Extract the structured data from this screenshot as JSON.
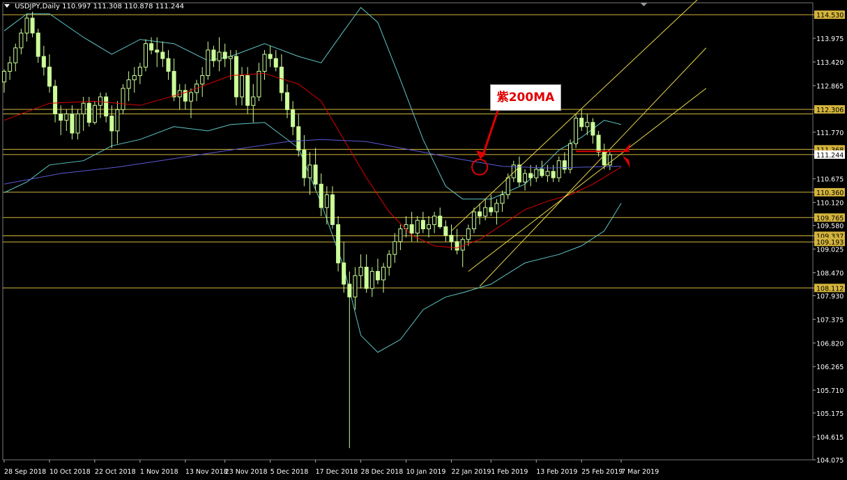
{
  "header": {
    "symbol": "USDJPY,Daily",
    "ohlc": "110.997 111.308 110.878 111.244"
  },
  "annotation": {
    "text": "紫200MA"
  },
  "colors": {
    "background": "#000000",
    "candle": "#ccff99",
    "bollinger": "#5fc7c7",
    "ma_red": "#e00000",
    "ma_purple": "#5a5ad6",
    "hline": "#d4b43c",
    "channel": "#e8d84a",
    "marker": "#e00000",
    "grid_text": "#ffffff"
  },
  "chart_data": {
    "type": "candlestick",
    "symbol": "USDJPY",
    "timeframe": "Daily",
    "ylim": [
      104.075,
      114.81
    ],
    "y_ticks": [
      114.53,
      113.975,
      113.42,
      112.865,
      112.306,
      111.77,
      111.368,
      111.244,
      110.675,
      110.36,
      110.12,
      109.765,
      109.58,
      109.337,
      109.193,
      109.025,
      108.47,
      108.112,
      107.93,
      107.375,
      106.82,
      106.265,
      105.71,
      105.175,
      104.615,
      104.075
    ],
    "highlighted_levels": [
      114.53,
      112.306,
      111.368,
      111.244,
      110.36,
      109.765,
      109.337,
      109.193,
      108.112
    ],
    "horizontal_lines": [
      114.53,
      112.306,
      112.2,
      111.368,
      111.244,
      110.36,
      109.765,
      109.337,
      109.193,
      108.112
    ],
    "x_tick_labels": [
      "28 Sep 2018",
      "10 Oct 2018",
      "22 Oct 2018",
      "1 Nov 2018",
      "13 Nov 2018",
      "23 Nov 2018",
      "5 Dec 2018",
      "17 Dec 2018",
      "28 Dec 2018",
      "10 Jan 2019",
      "22 Jan 2019",
      "1 Feb 2019",
      "13 Feb 2019",
      "25 Feb 2019",
      "7 Mar 2019"
    ],
    "x_tick_index": [
      0,
      8,
      16,
      24,
      32,
      39,
      47,
      55,
      63,
      71,
      79,
      86,
      94,
      102,
      109
    ],
    "candles": [
      [
        112.95,
        113.25,
        112.7,
        113.2
      ],
      [
        113.2,
        113.55,
        113.0,
        113.4
      ],
      [
        113.4,
        113.85,
        113.2,
        113.75
      ],
      [
        113.75,
        114.2,
        113.6,
        114.1
      ],
      [
        114.1,
        114.55,
        113.9,
        114.45
      ],
      [
        114.45,
        114.6,
        114.0,
        114.1
      ],
      [
        114.1,
        114.2,
        113.4,
        113.55
      ],
      [
        113.55,
        113.8,
        113.1,
        113.3
      ],
      [
        113.3,
        113.6,
        112.7,
        112.85
      ],
      [
        112.85,
        113.0,
        112.0,
        112.2
      ],
      [
        112.2,
        112.4,
        111.7,
        112.05
      ],
      [
        112.05,
        112.3,
        111.8,
        112.2
      ],
      [
        112.2,
        112.4,
        111.6,
        111.75
      ],
      [
        111.75,
        112.3,
        111.6,
        112.2
      ],
      [
        112.2,
        112.6,
        111.8,
        112.45
      ],
      [
        112.45,
        112.6,
        111.9,
        112.0
      ],
      [
        112.0,
        112.5,
        111.95,
        112.4
      ],
      [
        112.4,
        112.7,
        112.1,
        112.6
      ],
      [
        112.6,
        112.7,
        112.0,
        112.15
      ],
      [
        112.15,
        112.4,
        111.4,
        111.8
      ],
      [
        111.8,
        112.5,
        111.5,
        112.3
      ],
      [
        112.3,
        112.9,
        112.2,
        112.8
      ],
      [
        112.8,
        113.2,
        112.5,
        113.0
      ],
      [
        113.0,
        113.3,
        112.7,
        113.1
      ],
      [
        113.1,
        113.4,
        112.9,
        113.3
      ],
      [
        113.3,
        113.95,
        113.2,
        113.85
      ],
      [
        113.85,
        114.0,
        113.6,
        113.7
      ],
      [
        113.7,
        114.0,
        113.3,
        113.65
      ],
      [
        113.65,
        113.9,
        113.3,
        113.5
      ],
      [
        113.5,
        113.7,
        113.0,
        113.2
      ],
      [
        113.2,
        113.5,
        112.5,
        112.6
      ],
      [
        112.6,
        112.9,
        112.3,
        112.75
      ],
      [
        112.75,
        112.9,
        112.3,
        112.5
      ],
      [
        112.5,
        112.8,
        112.1,
        112.7
      ],
      [
        112.7,
        113.0,
        112.5,
        112.9
      ],
      [
        112.9,
        113.3,
        112.6,
        113.1
      ],
      [
        113.1,
        113.9,
        113.0,
        113.7
      ],
      [
        113.7,
        113.8,
        113.3,
        113.45
      ],
      [
        113.45,
        114.0,
        113.2,
        113.65
      ],
      [
        113.65,
        113.85,
        113.3,
        113.5
      ],
      [
        113.5,
        113.7,
        113.0,
        113.55
      ],
      [
        113.55,
        113.7,
        112.4,
        112.6
      ],
      [
        112.6,
        113.3,
        112.4,
        113.1
      ],
      [
        113.1,
        113.3,
        112.2,
        112.4
      ],
      [
        112.4,
        112.9,
        112.0,
        112.6
      ],
      [
        112.6,
        113.4,
        112.5,
        113.2
      ],
      [
        113.2,
        113.7,
        113.0,
        113.6
      ],
      [
        113.6,
        113.8,
        113.3,
        113.5
      ],
      [
        113.5,
        113.7,
        113.2,
        113.3
      ],
      [
        113.3,
        113.6,
        112.5,
        112.7
      ],
      [
        112.7,
        112.9,
        112.1,
        112.3
      ],
      [
        112.3,
        112.5,
        111.7,
        111.9
      ],
      [
        111.9,
        112.2,
        111.2,
        111.35
      ],
      [
        111.35,
        111.7,
        110.5,
        110.7
      ],
      [
        110.7,
        111.3,
        110.3,
        111.0
      ],
      [
        111.0,
        111.4,
        110.4,
        110.55
      ],
      [
        110.55,
        110.8,
        109.8,
        110.0
      ],
      [
        110.0,
        110.5,
        109.6,
        110.3
      ],
      [
        110.3,
        110.5,
        109.5,
        109.6
      ],
      [
        109.6,
        109.8,
        108.5,
        108.7
      ],
      [
        108.7,
        109.2,
        108.0,
        108.2
      ],
      [
        108.2,
        108.5,
        104.35,
        107.9
      ],
      [
        107.9,
        108.6,
        107.6,
        108.4
      ],
      [
        108.4,
        108.9,
        108.1,
        108.6
      ],
      [
        108.6,
        108.9,
        108.0,
        108.1
      ],
      [
        108.1,
        108.6,
        107.9,
        108.5
      ],
      [
        108.5,
        108.8,
        108.2,
        108.3
      ],
      [
        108.3,
        108.7,
        108.0,
        108.6
      ],
      [
        108.6,
        109.0,
        108.4,
        108.9
      ],
      [
        108.9,
        109.4,
        108.7,
        109.2
      ],
      [
        109.2,
        109.6,
        109.0,
        109.5
      ],
      [
        109.5,
        109.8,
        109.3,
        109.6
      ],
      [
        109.6,
        109.9,
        109.2,
        109.4
      ],
      [
        109.4,
        109.8,
        109.2,
        109.7
      ],
      [
        109.7,
        109.9,
        109.4,
        109.5
      ],
      [
        109.5,
        109.8,
        109.3,
        109.6
      ],
      [
        109.6,
        109.9,
        109.4,
        109.8
      ],
      [
        109.8,
        110.0,
        109.5,
        109.55
      ],
      [
        109.55,
        109.7,
        109.2,
        109.35
      ],
      [
        109.35,
        109.6,
        109.0,
        109.2
      ],
      [
        109.2,
        109.5,
        108.9,
        109.0
      ],
      [
        109.0,
        109.3,
        108.6,
        109.25
      ],
      [
        109.25,
        109.6,
        109.1,
        109.5
      ],
      [
        109.5,
        110.0,
        109.4,
        109.9
      ],
      [
        109.9,
        110.1,
        109.6,
        109.8
      ],
      [
        109.8,
        110.2,
        109.7,
        110.0
      ],
      [
        110.0,
        110.3,
        109.8,
        109.9
      ],
      [
        109.9,
        110.2,
        109.6,
        110.1
      ],
      [
        110.1,
        110.4,
        109.9,
        110.3
      ],
      [
        110.3,
        110.8,
        110.2,
        110.7
      ],
      [
        110.7,
        111.1,
        110.6,
        111.0
      ],
      [
        111.0,
        111.2,
        110.5,
        110.6
      ],
      [
        110.6,
        110.9,
        110.4,
        110.8
      ],
      [
        110.8,
        111.0,
        110.5,
        110.7
      ],
      [
        110.7,
        111.0,
        110.6,
        110.9
      ],
      [
        110.9,
        111.1,
        110.7,
        110.75
      ],
      [
        110.75,
        111.0,
        110.6,
        110.85
      ],
      [
        110.85,
        111.0,
        110.6,
        110.7
      ],
      [
        110.7,
        111.2,
        110.6,
        111.1
      ],
      [
        111.1,
        111.3,
        110.8,
        110.9
      ],
      [
        110.9,
        111.6,
        110.8,
        111.5
      ],
      [
        111.5,
        112.2,
        111.4,
        112.1
      ],
      [
        112.1,
        112.3,
        111.8,
        111.9
      ],
      [
        111.9,
        112.2,
        111.7,
        112.0
      ],
      [
        112.0,
        112.1,
        111.5,
        111.7
      ],
      [
        111.7,
        111.8,
        111.2,
        111.3
      ],
      [
        111.3,
        111.5,
        110.9,
        111.0
      ],
      [
        111.0,
        111.31,
        110.88,
        111.24
      ]
    ],
    "ma_red": [
      [
        0,
        112.05
      ],
      [
        8,
        112.45
      ],
      [
        16,
        112.5
      ],
      [
        24,
        112.4
      ],
      [
        32,
        112.7
      ],
      [
        40,
        113.1
      ],
      [
        46,
        113.15
      ],
      [
        52,
        112.9
      ],
      [
        56,
        112.5
      ],
      [
        60,
        111.6
      ],
      [
        64,
        110.7
      ],
      [
        68,
        109.9
      ],
      [
        72,
        109.35
      ],
      [
        76,
        109.1
      ],
      [
        80,
        109.05
      ],
      [
        84,
        109.25
      ],
      [
        88,
        109.6
      ],
      [
        92,
        109.95
      ],
      [
        96,
        110.15
      ],
      [
        100,
        110.3
      ],
      [
        104,
        110.55
      ],
      [
        109,
        110.95
      ]
    ],
    "ma_purple": [
      [
        0,
        110.55
      ],
      [
        10,
        110.8
      ],
      [
        20,
        110.95
      ],
      [
        30,
        111.15
      ],
      [
        40,
        111.35
      ],
      [
        50,
        111.55
      ],
      [
        56,
        111.6
      ],
      [
        64,
        111.55
      ],
      [
        72,
        111.35
      ],
      [
        80,
        111.15
      ],
      [
        88,
        110.97
      ],
      [
        96,
        110.93
      ],
      [
        109,
        110.97
      ]
    ],
    "bb_upper": [
      [
        0,
        114.15
      ],
      [
        4,
        114.55
      ],
      [
        8,
        114.55
      ],
      [
        14,
        114.0
      ],
      [
        19,
        113.6
      ],
      [
        24,
        113.95
      ],
      [
        30,
        113.85
      ],
      [
        36,
        113.45
      ],
      [
        40,
        113.55
      ],
      [
        46,
        113.85
      ],
      [
        52,
        113.55
      ],
      [
        56,
        113.4
      ],
      [
        60,
        114.15
      ],
      [
        63,
        114.7
      ],
      [
        66,
        114.35
      ],
      [
        70,
        113.0
      ],
      [
        74,
        111.6
      ],
      [
        78,
        110.5
      ],
      [
        81,
        110.2
      ],
      [
        86,
        110.2
      ],
      [
        92,
        110.55
      ],
      [
        98,
        111.35
      ],
      [
        102,
        111.65
      ],
      [
        106,
        112.05
      ],
      [
        109,
        111.95
      ]
    ],
    "bb_lower": [
      [
        0,
        110.35
      ],
      [
        4,
        110.6
      ],
      [
        8,
        111.0
      ],
      [
        14,
        111.1
      ],
      [
        19,
        111.45
      ],
      [
        24,
        111.6
      ],
      [
        30,
        111.9
      ],
      [
        36,
        111.8
      ],
      [
        40,
        111.95
      ],
      [
        46,
        112.0
      ],
      [
        52,
        111.4
      ],
      [
        56,
        110.1
      ],
      [
        60,
        108.6
      ],
      [
        63,
        107.0
      ],
      [
        66,
        106.6
      ],
      [
        70,
        106.9
      ],
      [
        74,
        107.6
      ],
      [
        78,
        107.9
      ],
      [
        81,
        108.0
      ],
      [
        86,
        108.2
      ],
      [
        92,
        108.7
      ],
      [
        98,
        108.9
      ],
      [
        102,
        109.1
      ],
      [
        106,
        109.45
      ],
      [
        109,
        110.1
      ]
    ],
    "channel_lines": [
      [
        [
          79,
          109.45
        ],
        [
          123,
          114.95
        ]
      ],
      [
        [
          82,
          108.5
        ],
        [
          124,
          112.8
        ]
      ],
      [
        [
          84,
          108.15
        ],
        [
          124,
          113.75
        ]
      ]
    ],
    "marker_circle_at": [
      84,
      110.95
    ],
    "red_hline": [
      [
        101,
        111.32
      ],
      [
        108,
        111.32
      ]
    ]
  }
}
